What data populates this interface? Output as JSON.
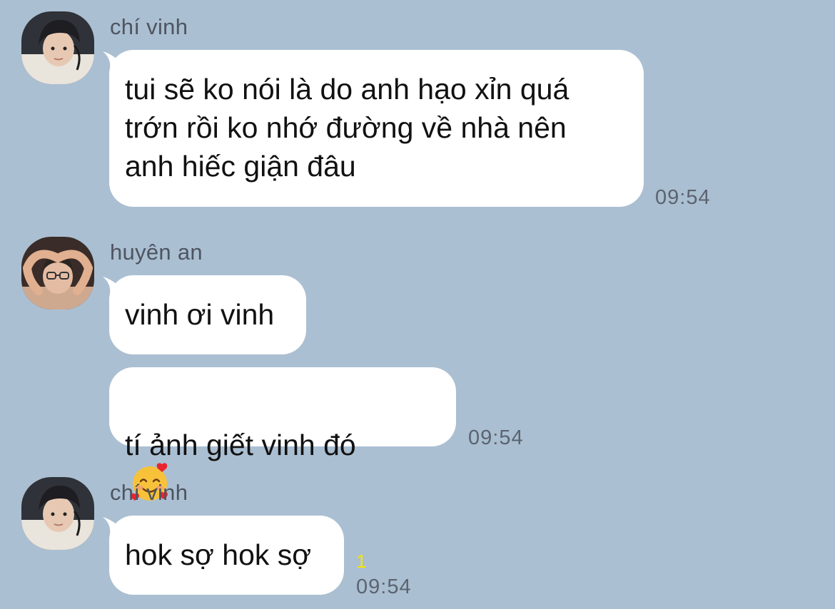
{
  "messages": [
    {
      "sender": "chí vinh",
      "avatar": "avatar-chi-vinh",
      "bubbles": [
        {
          "text": "tui sẽ ko nói là do anh hạo xỉn quá\ntrớn rồi ko nhớ đường về nhà nên\nanh hiếc giận đâu"
        }
      ],
      "time": "09:54"
    },
    {
      "sender": "huyên an",
      "avatar": "avatar-huyen-an",
      "bubbles": [
        {
          "text": "vinh ơi vinh"
        },
        {
          "text": "tí ảnh giết vinh đó",
          "emoji": "smiling-face-with-hearts-icon"
        }
      ],
      "time": "09:54"
    },
    {
      "sender": "chí vinh",
      "avatar": "avatar-chi-vinh",
      "bubbles": [
        {
          "text": "hok sợ hok sợ"
        }
      ],
      "unread_count": "1",
      "time": "09:54"
    }
  ],
  "colors": {
    "background": "#abbfd2",
    "bubble": "#ffffff",
    "sender_text": "#4e5560",
    "timestamp_text": "#5b6470",
    "unread_badge": "#f7e500"
  }
}
